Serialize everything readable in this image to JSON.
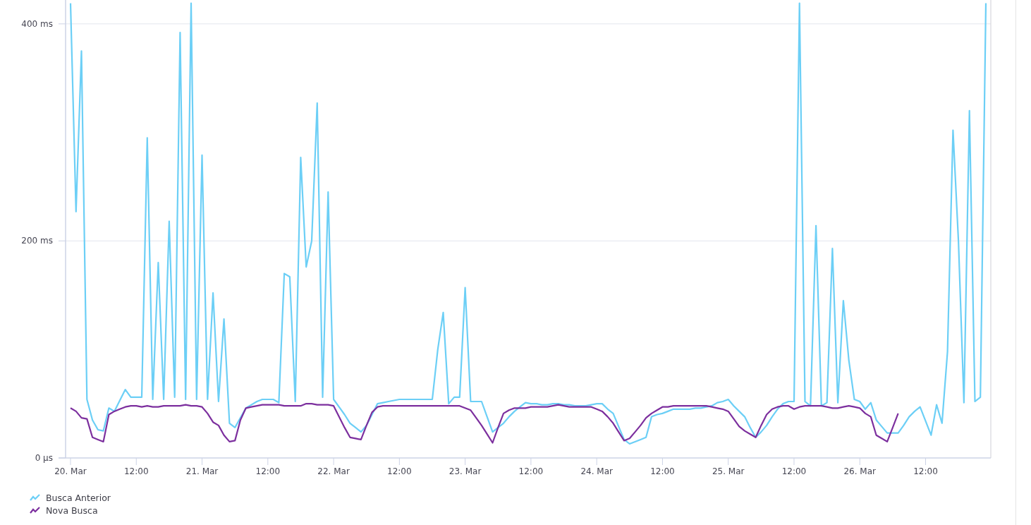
{
  "chart": {
    "chart_data": {
      "type": "line",
      "categories": [
        "20. Mar",
        null,
        null,
        null,
        null,
        null,
        null,
        null,
        null,
        null,
        null,
        null,
        "12:00",
        null,
        null,
        null,
        null,
        null,
        null,
        null,
        null,
        null,
        null,
        null,
        "21. Mar",
        null,
        null,
        null,
        null,
        null,
        null,
        null,
        null,
        null,
        null,
        null,
        "12:00",
        null,
        null,
        null,
        null,
        null,
        null,
        null,
        null,
        null,
        null,
        null,
        "22. Mar",
        null,
        null,
        null,
        null,
        null,
        null,
        null,
        null,
        null,
        null,
        null,
        "12:00",
        null,
        null,
        null,
        null,
        null,
        null,
        null,
        null,
        null,
        null,
        null,
        "23. Mar",
        null,
        null,
        null,
        null,
        null,
        null,
        null,
        null,
        null,
        null,
        null,
        "12:00",
        null,
        null,
        null,
        null,
        null,
        null,
        null,
        null,
        null,
        null,
        null,
        "24. Mar",
        null,
        null,
        null,
        null,
        null,
        null,
        null,
        null,
        null,
        null,
        null,
        "12:00",
        null,
        null,
        null,
        null,
        null,
        null,
        null,
        null,
        null,
        null,
        null,
        "25. Mar",
        null,
        null,
        null,
        null,
        null,
        null,
        null,
        null,
        null,
        null,
        null,
        "12:00",
        null,
        null,
        null,
        null,
        null,
        null,
        null,
        null,
        null,
        null,
        null,
        "26. Mar",
        null,
        null,
        null,
        null,
        null,
        null,
        null,
        null,
        null,
        null,
        null,
        "12:00",
        null,
        null,
        null,
        null,
        null,
        null,
        null,
        null,
        null,
        null,
        null
      ],
      "series": [
        {
          "name": "Busca Anterior",
          "color": "#6ccff6",
          "values": [
            419,
            227,
            375,
            54,
            35,
            26,
            25,
            46,
            43,
            53,
            63,
            56,
            56,
            56,
            295,
            54,
            180,
            54,
            218,
            56,
            392,
            54,
            419,
            54,
            279,
            54,
            152,
            52,
            128,
            32,
            28,
            37,
            46,
            49,
            52,
            54,
            54,
            54,
            51,
            170,
            167,
            52,
            277,
            176,
            200,
            327,
            56,
            245,
            54,
            47,
            40,
            32,
            28,
            24,
            30,
            40,
            50,
            51,
            52,
            53,
            54,
            54,
            54,
            54,
            54,
            54,
            54,
            100,
            134,
            50,
            56,
            56,
            157,
            52,
            52,
            52,
            38,
            24,
            28,
            32,
            38,
            43,
            47,
            51,
            50,
            50,
            49,
            49,
            50,
            50,
            49,
            49,
            48,
            48,
            48,
            49,
            50,
            50,
            45,
            41,
            29,
            17,
            13,
            15,
            17,
            19,
            38,
            40,
            41,
            43,
            45,
            45,
            45,
            45,
            46,
            46,
            47,
            48,
            51,
            52,
            54,
            48,
            43,
            38,
            28,
            19,
            24,
            30,
            38,
            45,
            50,
            52,
            52,
            419,
            52,
            48,
            214,
            48,
            51,
            193,
            51,
            145,
            90,
            54,
            52,
            45,
            51,
            35,
            29,
            23,
            23,
            23,
            30,
            38,
            43,
            47,
            34,
            21,
            49,
            32,
            98,
            302,
            200,
            51,
            320,
            52,
            56,
            419
          ]
        },
        {
          "name": "Nova Busca",
          "color": "#7c2f9e",
          "values": [
            46,
            43,
            37,
            36,
            19,
            17,
            15,
            40,
            43,
            45,
            47,
            48,
            48,
            47,
            48,
            47,
            47,
            48,
            48,
            48,
            48,
            49,
            48,
            48,
            47,
            41,
            33,
            30,
            21,
            15,
            16,
            35,
            46,
            47,
            48,
            49,
            49,
            49,
            49,
            48,
            48,
            48,
            48,
            50,
            50,
            49,
            49,
            49,
            48,
            38,
            28,
            19,
            18,
            17,
            30,
            42,
            47,
            48,
            48,
            48,
            48,
            48,
            48,
            48,
            48,
            48,
            48,
            48,
            48,
            48,
            48,
            48,
            46,
            44,
            37,
            30,
            22,
            14,
            28,
            41,
            44,
            46,
            46,
            46,
            47,
            47,
            47,
            47,
            48,
            49,
            48,
            47,
            47,
            47,
            47,
            47,
            45,
            43,
            38,
            32,
            24,
            16,
            18,
            24,
            30,
            37,
            41,
            44,
            47,
            47,
            48,
            48,
            48,
            48,
            48,
            48,
            48,
            47,
            46,
            45,
            43,
            36,
            29,
            25,
            22,
            19,
            30,
            40,
            45,
            47,
            48,
            48,
            45,
            47,
            48,
            48,
            48,
            48,
            47,
            46,
            46,
            47,
            48,
            47,
            46,
            41,
            38,
            21,
            18,
            15,
            28,
            41,
            null,
            null,
            null,
            null,
            null,
            null,
            null,
            null,
            null,
            null,
            null,
            null,
            null,
            null,
            null,
            null
          ]
        }
      ],
      "ylim": [
        0,
        422
      ],
      "yticks": [
        {
          "value": 0,
          "label": "0 µs"
        },
        {
          "value": 200,
          "label": "200 ms"
        },
        {
          "value": 400,
          "label": "400 ms"
        }
      ]
    }
  }
}
